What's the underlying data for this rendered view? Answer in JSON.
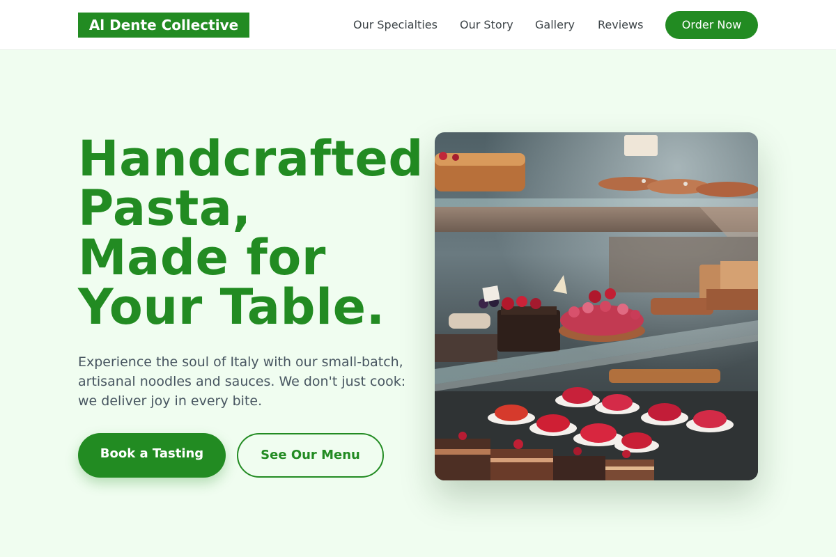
{
  "brand": {
    "name": "Al Dente Collective",
    "accent": "#228b22"
  },
  "nav": {
    "links": [
      "Our Specialties",
      "Our Story",
      "Gallery",
      "Reviews"
    ],
    "cta": "Order Now"
  },
  "hero": {
    "headline_lines": [
      "Handcrafted",
      "Pasta,",
      "Made for",
      "Your Table."
    ],
    "subtext": "Experience the soul of Italy with our small-batch, artisanal noodles and sauces. We don't just cook: we deliver joy in every bite.",
    "primary_button": "Book a Tasting",
    "secondary_button": "See Our Menu",
    "image": "pastry-display-case-photo"
  },
  "colors": {
    "background": "#f0fdf0",
    "text": "#475560",
    "nav_text": "#3d4448"
  }
}
